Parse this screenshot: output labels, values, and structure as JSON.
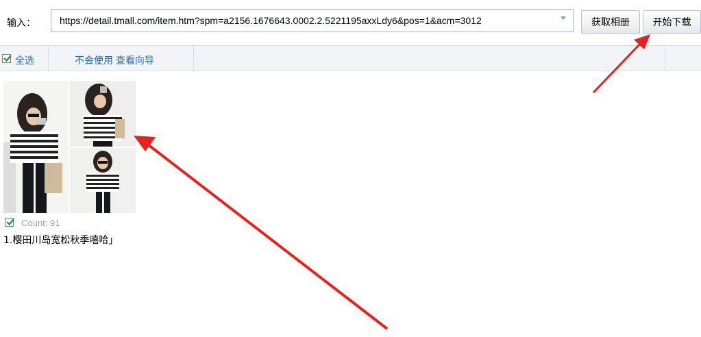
{
  "header": {
    "input_label": "输入：",
    "url_value": "https://detail.tmall.com/item.htm?spm=a2156.1676643.0002.2.5221195axxLdy6&pos=1&acm=3012",
    "fetch_album_label": "获取相册",
    "start_download_label": "开始下载"
  },
  "toolbar": {
    "select_all_label": "全选",
    "help_link_label": "不会使用 查看向导"
  },
  "album": {
    "count_label": "Count: 91",
    "title": "1.樱田川岛宽松秋季嘻哈」"
  },
  "colors": {
    "accent_blue": "#1f6cc2",
    "annotation_red": "#e8211f"
  }
}
